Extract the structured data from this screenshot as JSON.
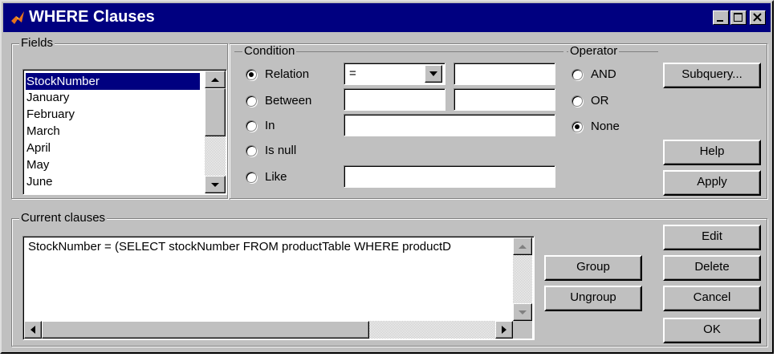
{
  "window": {
    "title": "WHERE Clauses"
  },
  "fields": {
    "label": "Fields",
    "items": [
      "StockNumber",
      "January",
      "February",
      "March",
      "April",
      "May",
      "June"
    ],
    "selected": "StockNumber"
  },
  "condition": {
    "label": "Condition",
    "options": [
      {
        "label": "Relation",
        "checked": true
      },
      {
        "label": "Between",
        "checked": false
      },
      {
        "label": "In",
        "checked": false
      },
      {
        "label": "Is null",
        "checked": false
      },
      {
        "label": "Like",
        "checked": false
      }
    ],
    "relation_value": "=",
    "relation_text": "",
    "between_from": "",
    "between_to": "",
    "in_text": "",
    "like_text": ""
  },
  "operator": {
    "label": "Operator",
    "options": [
      {
        "label": "AND",
        "checked": false
      },
      {
        "label": "OR",
        "checked": false
      },
      {
        "label": "None",
        "checked": true
      }
    ]
  },
  "buttons": {
    "subquery": "Subquery...",
    "help": "Help",
    "apply": "Apply",
    "edit": "Edit",
    "delete": "Delete",
    "cancel": "Cancel",
    "ok": "OK",
    "group": "Group",
    "ungroup": "Ungroup"
  },
  "current_clauses": {
    "label": "Current clauses",
    "text": "StockNumber = (SELECT stockNumber FROM productTable WHERE productD"
  },
  "colors": {
    "titlebar": "#000080",
    "face": "#c0c0c0",
    "selection": "#000080"
  },
  "icons": [
    "matlab-icon",
    "minimize-icon",
    "maximize-icon",
    "close-icon",
    "chevron-down-icon",
    "arrow-up-icon",
    "arrow-down-icon",
    "arrow-left-icon",
    "arrow-right-icon"
  ]
}
